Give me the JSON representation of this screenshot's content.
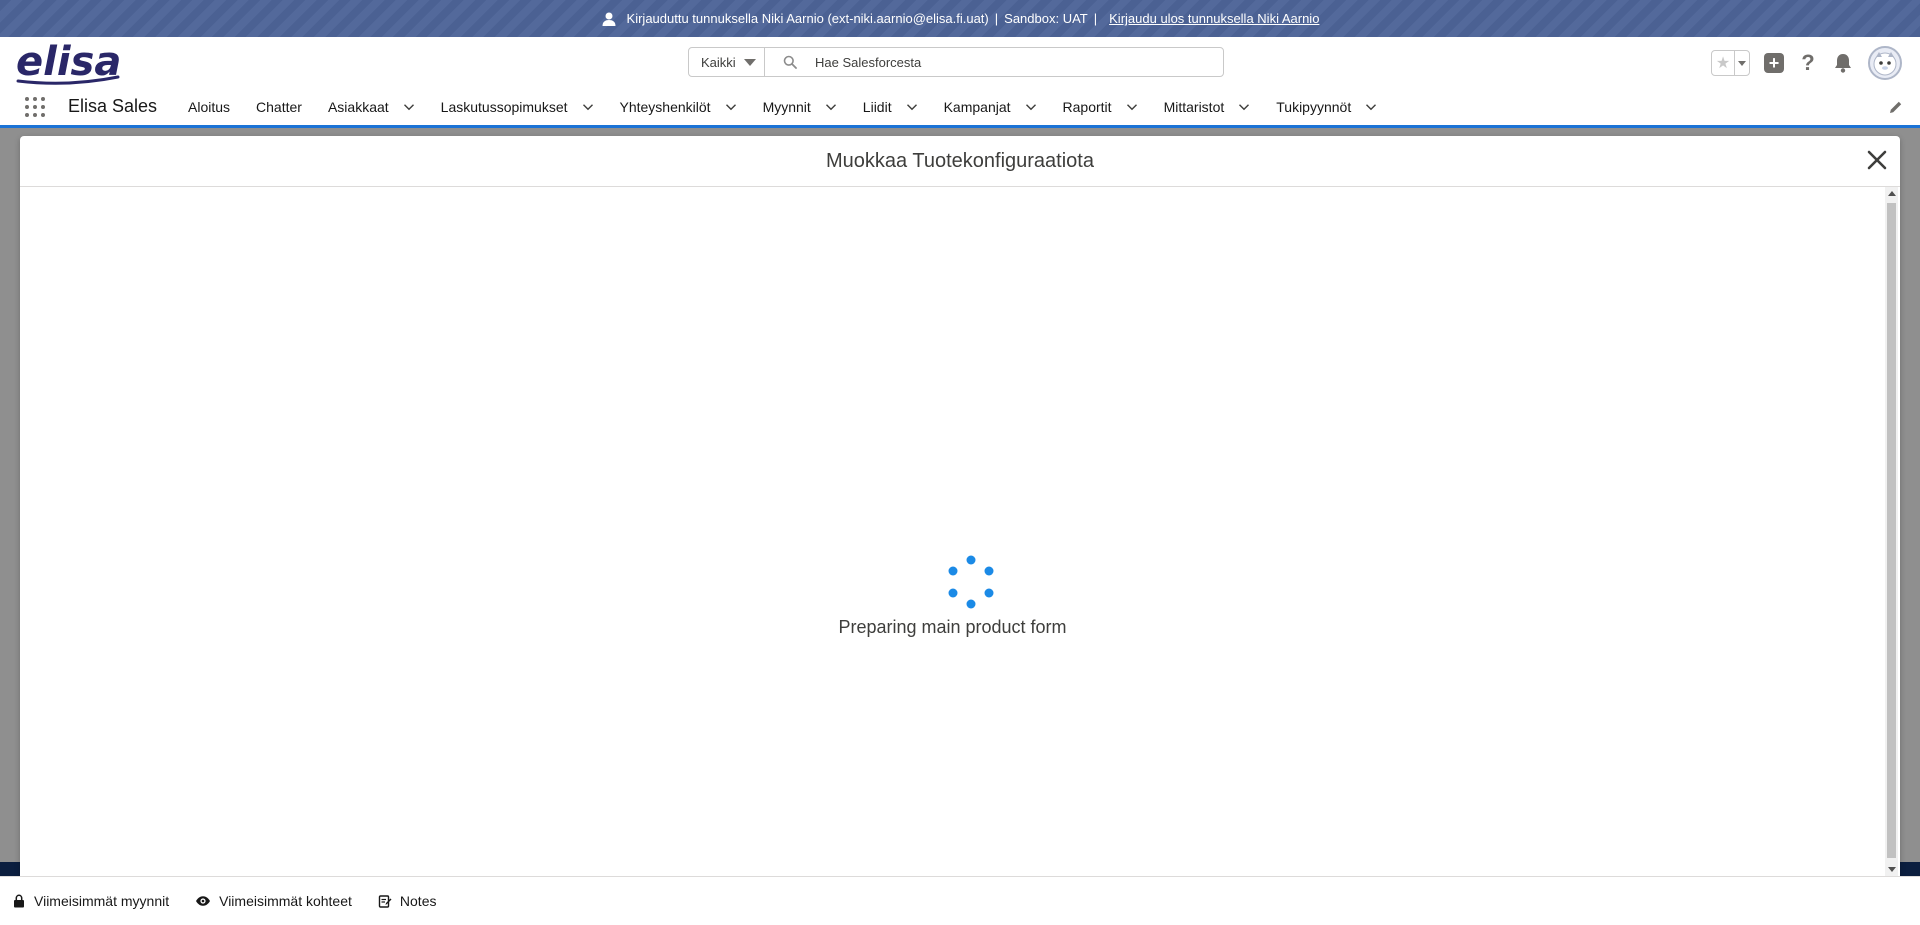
{
  "banner": {
    "logged_in_text": "Kirjauduttu tunnuksella Niki Aarnio (ext-niki.aarnio@elisa.fi.uat)",
    "separator": "|",
    "sandbox_text": "Sandbox: UAT",
    "separator2": "|",
    "logout_link": "Kirjaudu ulos tunnuksella Niki Aarnio"
  },
  "header": {
    "logo_text": "elisa",
    "search_scope": "Kaikki",
    "search_placeholder": "Hae Salesforcesta"
  },
  "nav": {
    "app_name": "Elisa Sales",
    "items": [
      {
        "label": "Aloitus",
        "has_menu": false
      },
      {
        "label": "Chatter",
        "has_menu": false
      },
      {
        "label": "Asiakkaat",
        "has_menu": true
      },
      {
        "label": "Laskutussopimukset",
        "has_menu": true
      },
      {
        "label": "Yhteyshenkilöt",
        "has_menu": true
      },
      {
        "label": "Myynnit",
        "has_menu": true
      },
      {
        "label": "Liidit",
        "has_menu": true
      },
      {
        "label": "Kampanjat",
        "has_menu": true
      },
      {
        "label": "Raportit",
        "has_menu": true
      },
      {
        "label": "Mittaristot",
        "has_menu": true
      },
      {
        "label": "Tukipyynnöt",
        "has_menu": true
      }
    ]
  },
  "modal": {
    "title": "Muokkaa Tuotekonfiguraatiota",
    "loading_text": "Preparing main product form"
  },
  "utility_bar": {
    "items": [
      {
        "label": "Viimeisimmät myynnit",
        "icon": "lock-icon"
      },
      {
        "label": "Viimeisimmät kohteet",
        "icon": "eye-icon"
      },
      {
        "label": "Notes",
        "icon": "note-icon"
      }
    ]
  },
  "colors": {
    "brand_blue": "#1b73d6",
    "banner_bg": "#4b6193",
    "logo_purple": "#2a2768",
    "spinner_blue": "#1b8ae6"
  }
}
